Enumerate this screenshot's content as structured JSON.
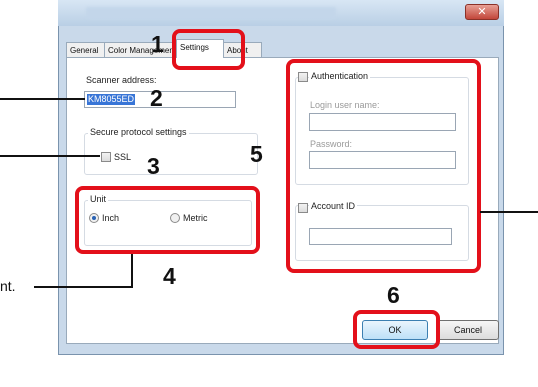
{
  "dialog": {
    "close_glyph": "✕"
  },
  "tabs": [
    {
      "label": "General"
    },
    {
      "label": "Color Management"
    },
    {
      "label": "Settings"
    },
    {
      "label": "About"
    }
  ],
  "scanner": {
    "label": "Scanner address:",
    "value": "KM8055ED"
  },
  "secure": {
    "legend": "Secure protocol settings",
    "ssl_label": "SSL"
  },
  "unit": {
    "legend": "Unit",
    "inch_label": "Inch",
    "metric_label": "Metric",
    "selected": "Inch"
  },
  "authentication": {
    "label": "Authentication",
    "login_label": "Login user name:",
    "password_label": "Password:"
  },
  "account": {
    "label": "Account ID"
  },
  "buttons": {
    "ok": "OK",
    "cancel": "Cancel"
  },
  "callouts": {
    "n1": "1",
    "n2": "2",
    "n3": "3",
    "n4": "4",
    "n5": "5",
    "n6": "6",
    "side_text": "nt."
  },
  "colors": {
    "highlight": "#e3101a",
    "selection": "#3875d7"
  }
}
